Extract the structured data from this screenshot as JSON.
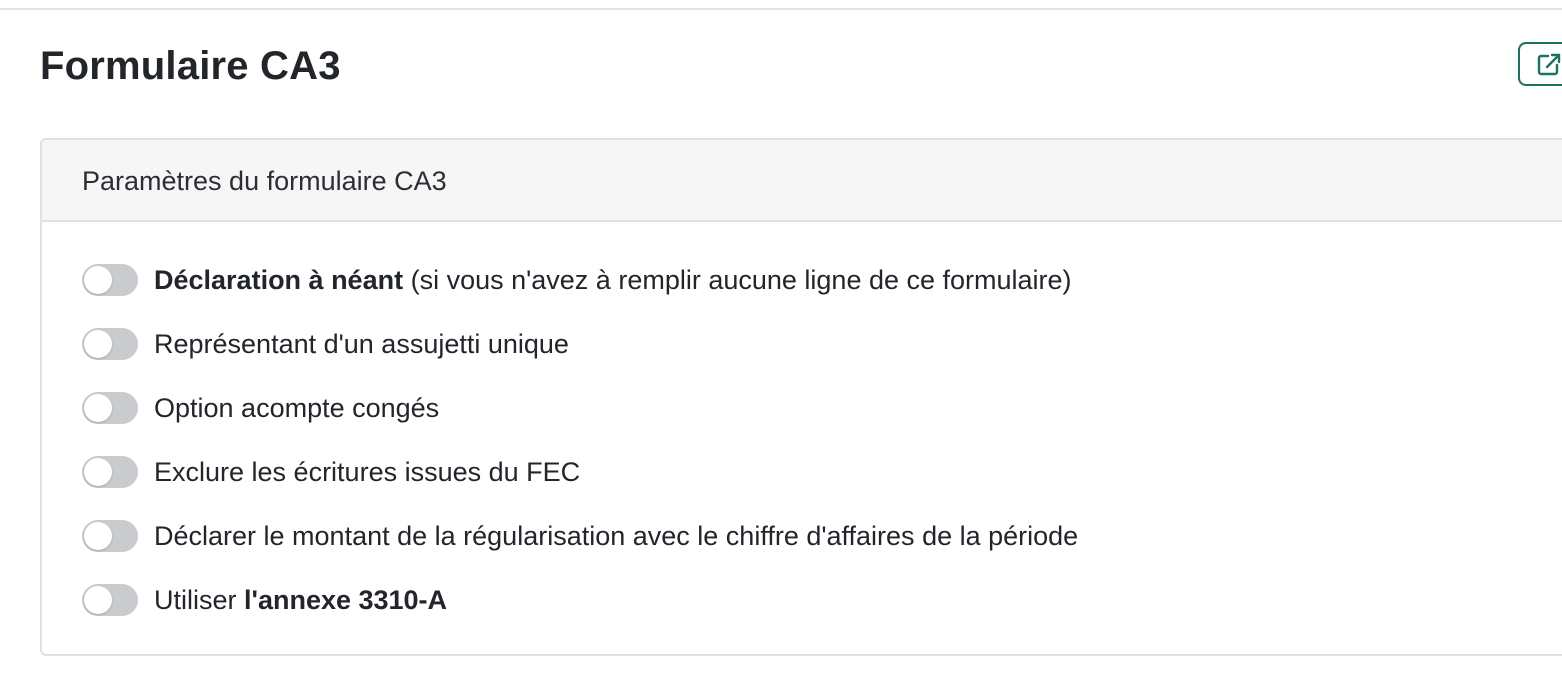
{
  "page": {
    "title": "Formulaire CA3"
  },
  "header_actions": {
    "open_external_icon": "external-link-icon",
    "accent_color": "#1a7263"
  },
  "card": {
    "title": "Paramètres du formulaire CA3",
    "options": [
      {
        "label_bold": "Déclaration à néant",
        "label_rest": " (si vous n'avez à remplir aucune ligne de ce formulaire)",
        "checked": false
      },
      {
        "label_plain": "Représentant d'un assujetti unique",
        "checked": false
      },
      {
        "label_plain": "Option acompte congés",
        "checked": false
      },
      {
        "label_plain": "Exclure les écritures issues du FEC",
        "checked": false
      },
      {
        "label_plain": "Déclarer le montant de la régularisation avec le chiffre d'affaires de la période",
        "checked": false
      },
      {
        "label_prefix": "Utiliser ",
        "label_bold": "l'annexe 3310-A",
        "checked": false
      }
    ]
  },
  "colors": {
    "toggle_off": "#c9cbcf",
    "border": "#dfe0e2",
    "header_bg": "#f6f6f7"
  }
}
